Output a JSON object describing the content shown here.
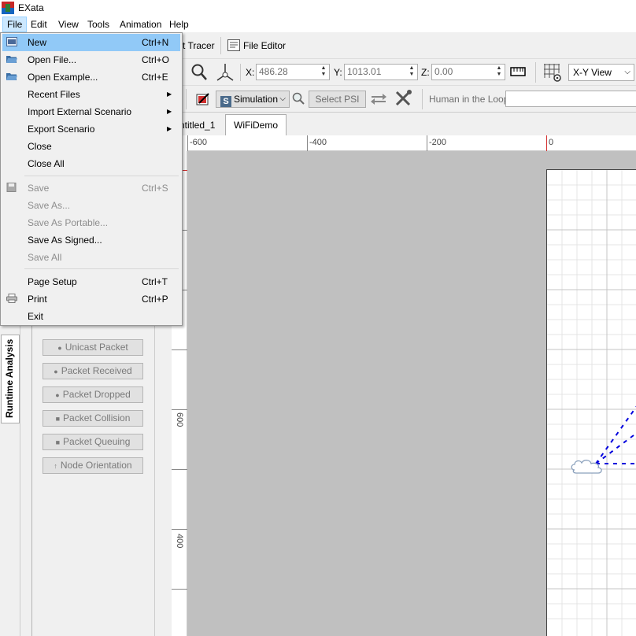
{
  "window": {
    "title": "EXata"
  },
  "menubar": [
    "File",
    "Edit",
    "View",
    "Tools",
    "Animation",
    "Help"
  ],
  "toolbar1": {
    "tracer_label": "t Tracer",
    "file_editor_label": "File Editor"
  },
  "toolbar2": {
    "x_label": "X:",
    "x_value": "486.28",
    "y_label": "Y:",
    "y_value": "1013.01",
    "z_label": "Z:",
    "z_value": "0.00",
    "view_select": "X-Y View"
  },
  "toolbar3": {
    "mode_select": "Simulation",
    "select_psi": "Select PSI",
    "hitl_label": "Human in the Loop:",
    "hitl_value": ""
  },
  "tabs": [
    {
      "label": "ntitled_1",
      "selected": false
    },
    {
      "label": "WiFiDemo",
      "selected": true
    }
  ],
  "left_tab": "Runtime Analysis",
  "animation_buttons": [
    {
      "label": "Unicast Packet",
      "icon": "packet-icon"
    },
    {
      "label": "Packet Received",
      "icon": "packet-received-icon"
    },
    {
      "label": "Packet Dropped",
      "icon": "packet-dropped-icon"
    },
    {
      "label": "Packet Collision",
      "icon": "packet-collision-icon"
    },
    {
      "label": "Packet Queuing",
      "icon": "packet-queuing-icon"
    },
    {
      "label": "Node Orientation",
      "icon": "node-orientation-icon"
    }
  ],
  "rulers": {
    "x_ticks": [
      "-600",
      "-400",
      "-200",
      "0"
    ],
    "y_ticks": [
      "600",
      "400"
    ]
  },
  "file_menu": {
    "items": [
      {
        "label": "New",
        "shortcut": "Ctrl+N",
        "icon": "new-icon",
        "highlighted": true
      },
      {
        "label": "Open File...",
        "shortcut": "Ctrl+O",
        "icon": "open-folder-icon"
      },
      {
        "label": "Open Example...",
        "shortcut": "Ctrl+E",
        "icon": "open-folder-icon"
      },
      {
        "label": "Recent Files",
        "submenu": true
      },
      {
        "label": "Import External Scenario",
        "submenu": true
      },
      {
        "label": "Export Scenario",
        "submenu": true
      },
      {
        "label": "Close"
      },
      {
        "label": "Close All"
      },
      {
        "label": "Save",
        "shortcut": "Ctrl+S",
        "icon": "save-icon",
        "disabled": true
      },
      {
        "label": "Save As...",
        "disabled": true
      },
      {
        "label": "Save As Portable...",
        "disabled": true
      },
      {
        "label": "Save As Signed..."
      },
      {
        "label": "Save All",
        "disabled": true
      },
      {
        "label": "Page Setup",
        "shortcut": "Ctrl+T"
      },
      {
        "label": "Print",
        "shortcut": "Ctrl+P",
        "icon": "printer-icon"
      },
      {
        "label": "Exit"
      }
    ]
  },
  "colors": {
    "menu_highlight": "#91c9f7",
    "canvas_gray": "#c0c0c0",
    "link_blue": "#0000dd"
  }
}
